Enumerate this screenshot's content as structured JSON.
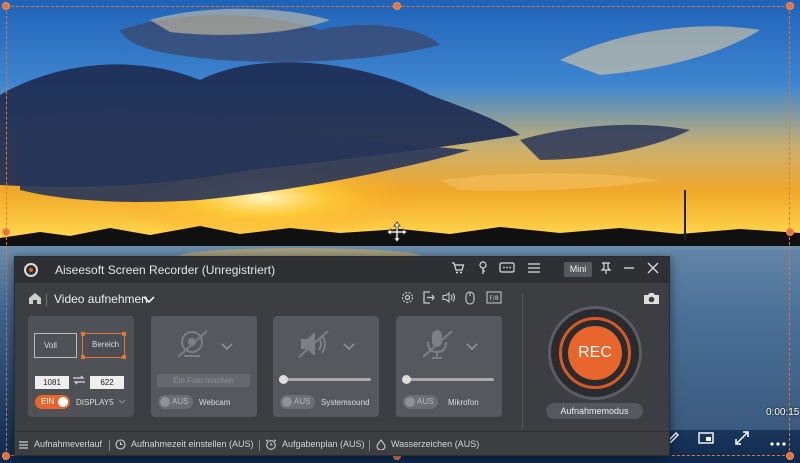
{
  "app": {
    "title": "Aiseesoft Screen Recorder (Unregistriert)",
    "mini_label": "Mini"
  },
  "header": {
    "mode_label": "Video aufnehmen"
  },
  "display_card": {
    "full_label": "Voll",
    "region_label": "Bereich",
    "width": "1081",
    "height": "622",
    "toggle_label": "EIN",
    "display_label": "DISPLAY5"
  },
  "webcam_card": {
    "photo_label": "Ein Foto machen",
    "toggle_label": "AUS",
    "label": "Webcam"
  },
  "system_card": {
    "toggle_label": "AUS",
    "label": "Systemsound"
  },
  "mic_card": {
    "toggle_label": "AUS",
    "label": "Mikrofon"
  },
  "record": {
    "rec_label": "REC",
    "mode_button_label": "Aufnahmemodus"
  },
  "bottom_bar": {
    "history": "Aufnahmeverlauf",
    "set_time": "Aufnahmezeit einstellen (AUS)",
    "schedule": "Aufgabenplan (AUS)",
    "watermark": "Wasserzeichen (AUS)"
  },
  "overlay": {
    "timer": "0:00:15"
  },
  "colors": {
    "accent": "#e8652b",
    "panel": "#3c3e42",
    "card": "#55585d"
  }
}
